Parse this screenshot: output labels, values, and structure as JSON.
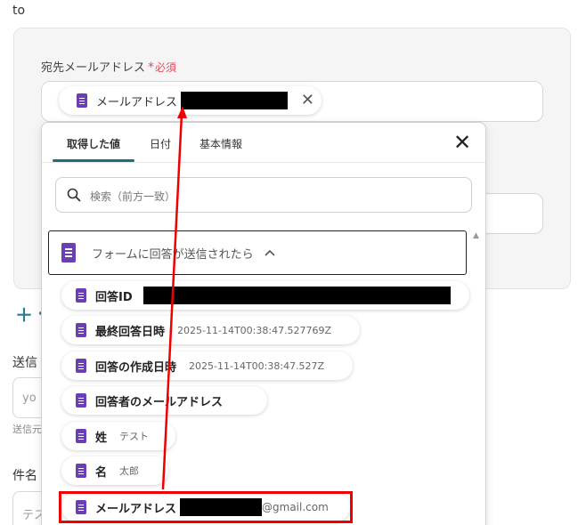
{
  "section_label": "to",
  "recipient": {
    "label": "宛先メールアドレス",
    "required_star": "*",
    "required_text": "必須",
    "chip_label": "メールアドレス",
    "chip_close": "✕"
  },
  "add_button": "＋",
  "sender_label": "送信",
  "sender_input_partial": "yo",
  "sender_hint_partial": "送信元",
  "subject_label": "件名",
  "subject_input_partial": "テス",
  "dropdown": {
    "tabs": [
      {
        "label": "取得した値",
        "active": true
      },
      {
        "label": "日付",
        "active": false
      },
      {
        "label": "基本情報",
        "active": false
      }
    ],
    "close_label": "✕",
    "search_placeholder": "検索（前方一致）",
    "group_title": "フォームに回答が送信されたら",
    "group_chevron": "^",
    "items": [
      {
        "label": "回答ID",
        "value": ""
      },
      {
        "label": "最終回答日時",
        "value": "2025-11-14T00:38:47.527769Z"
      },
      {
        "label": "回答の作成日時",
        "value": "2025-11-14T00:38:47.527Z"
      },
      {
        "label": "回答者のメールアドレス",
        "value": ""
      },
      {
        "label": "姓",
        "value": "テスト"
      },
      {
        "label": "名",
        "value": "太郎"
      },
      {
        "label": "メールアドレス",
        "value": "@gmail.com"
      }
    ]
  },
  "colors": {
    "accent": "#1f6f7a",
    "form_icon": "#6a3fb5",
    "required": "#e04f5f",
    "annotation": "#e00000"
  }
}
